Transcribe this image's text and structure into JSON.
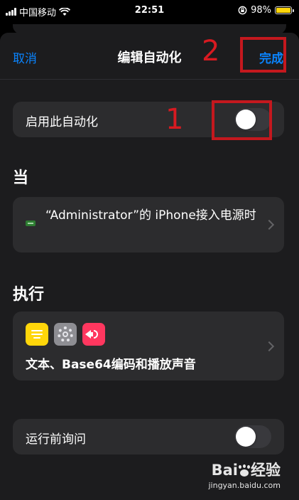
{
  "status_bar": {
    "carrier": "中国移动",
    "time": "22:51",
    "battery": "98%",
    "battery_level": 0.98,
    "icons": [
      "signal-icon",
      "wifi-icon",
      "orientation-lock-icon",
      "battery-icon"
    ]
  },
  "nav": {
    "cancel_label": "取消",
    "title": "编辑自动化",
    "done_label": "完成"
  },
  "enable_row": {
    "label": "启用此自动化",
    "toggle_on": false
  },
  "when_section": {
    "heading": "当",
    "trigger_text": "“Administrator”的 iPhone接入电源时",
    "trigger_icon": "power-plug-icon"
  },
  "do_section": {
    "heading": "执行",
    "action_icons": [
      "text-icon",
      "gear-icon",
      "sound-icon"
    ],
    "action_text": "文本、Base64编码和播放声音"
  },
  "ask_row": {
    "label": "运行前询问",
    "toggle_on": false
  },
  "annotations": {
    "step1": "1",
    "step2": "2",
    "color": "#c4181e"
  },
  "watermark": {
    "logo": "Bai du 经验",
    "url": "jingyan.baidu.com"
  },
  "colors": {
    "accent": "#0a84ff",
    "card": "#2c2c2e",
    "background": "#1c1c1e"
  }
}
